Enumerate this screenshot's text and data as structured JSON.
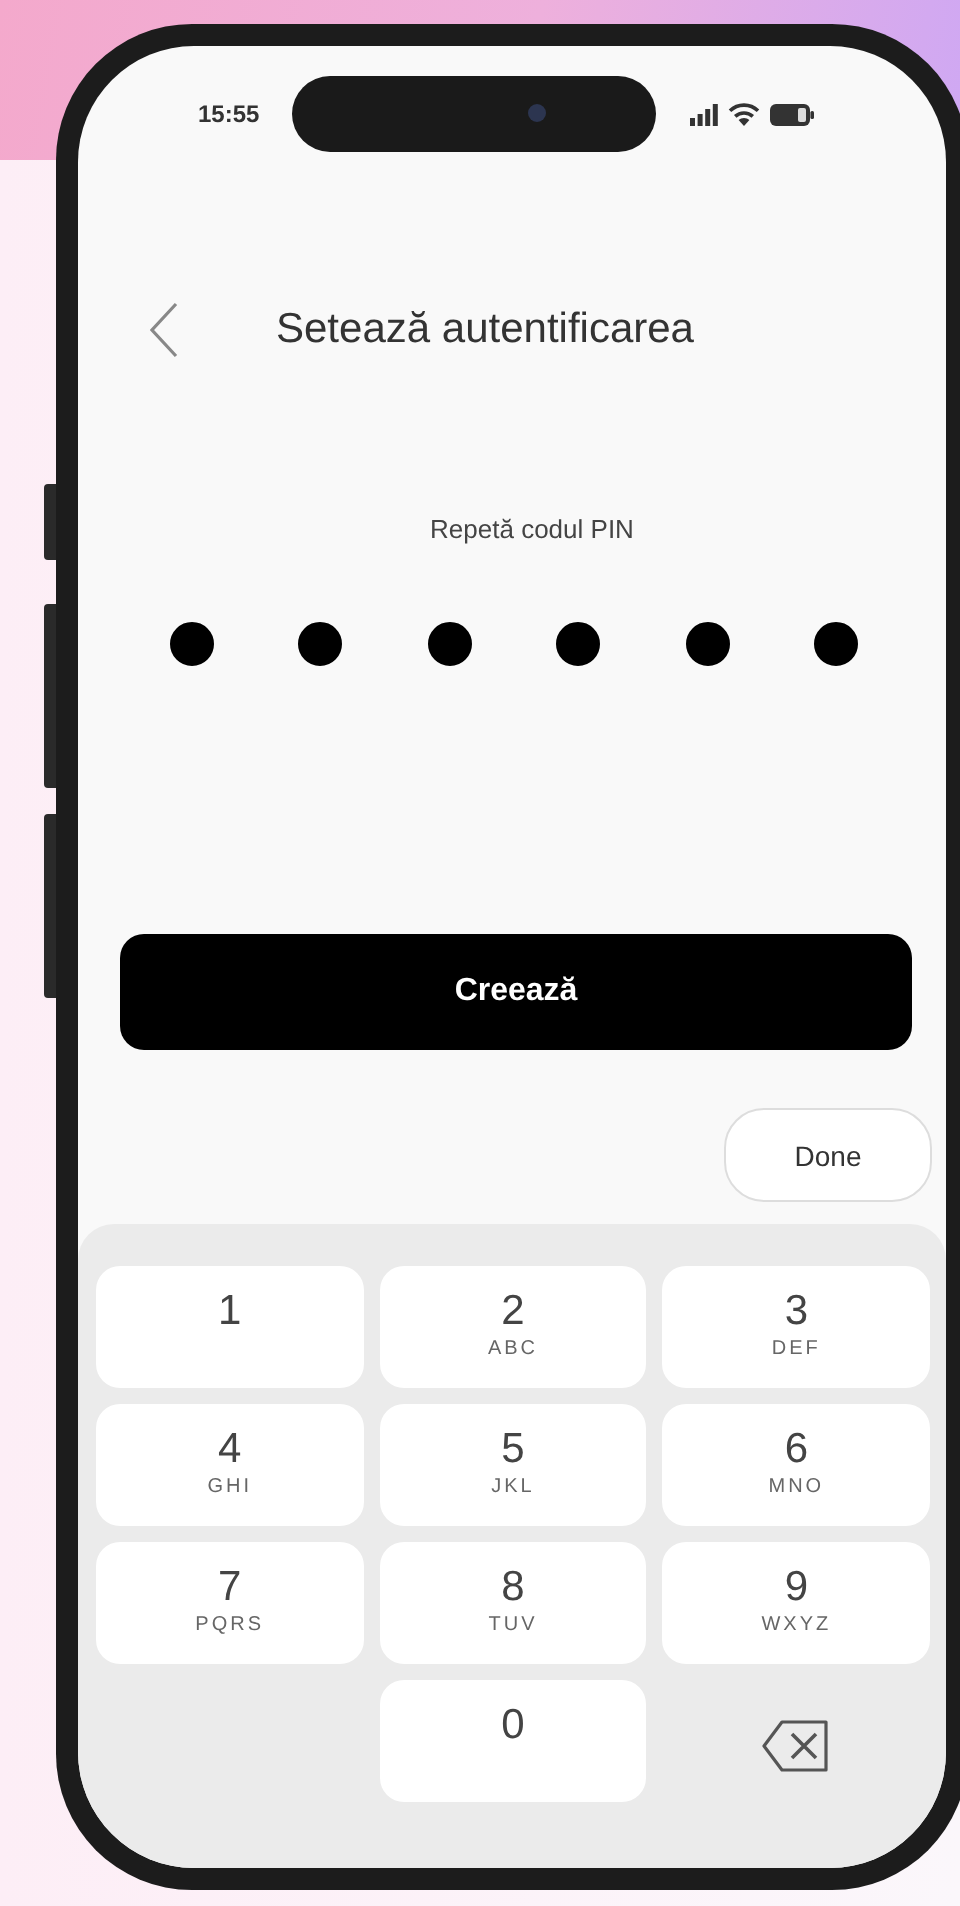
{
  "status_bar": {
    "time": "15:55"
  },
  "header": {
    "title": "Setează autentificarea"
  },
  "pin": {
    "label": "Repetă codul PIN",
    "dots": [
      {
        "filled": true
      },
      {
        "filled": true
      },
      {
        "filled": true
      },
      {
        "filled": true
      },
      {
        "filled": true
      },
      {
        "filled": true
      }
    ]
  },
  "primary_button": {
    "label": "Creează"
  },
  "done_button": {
    "label": "Done"
  },
  "keypad": [
    {
      "kind": "digit",
      "digit": "1"
    },
    {
      "kind": "digit",
      "digit": "2",
      "letters": "ABC"
    },
    {
      "kind": "digit",
      "digit": "3",
      "letters": "DEF"
    },
    {
      "kind": "digit",
      "digit": "4",
      "letters": "GHI"
    },
    {
      "kind": "digit",
      "digit": "5",
      "letters": "JKL"
    },
    {
      "kind": "digit",
      "digit": "6",
      "letters": "MNO"
    },
    {
      "kind": "digit",
      "digit": "7",
      "letters": "PQRS"
    },
    {
      "kind": "digit",
      "digit": "8",
      "letters": "TUV"
    },
    {
      "kind": "digit",
      "digit": "9",
      "letters": "WXYZ"
    },
    {
      "kind": "blank"
    },
    {
      "kind": "digit",
      "digit": "0"
    },
    {
      "kind": "delete"
    }
  ]
}
